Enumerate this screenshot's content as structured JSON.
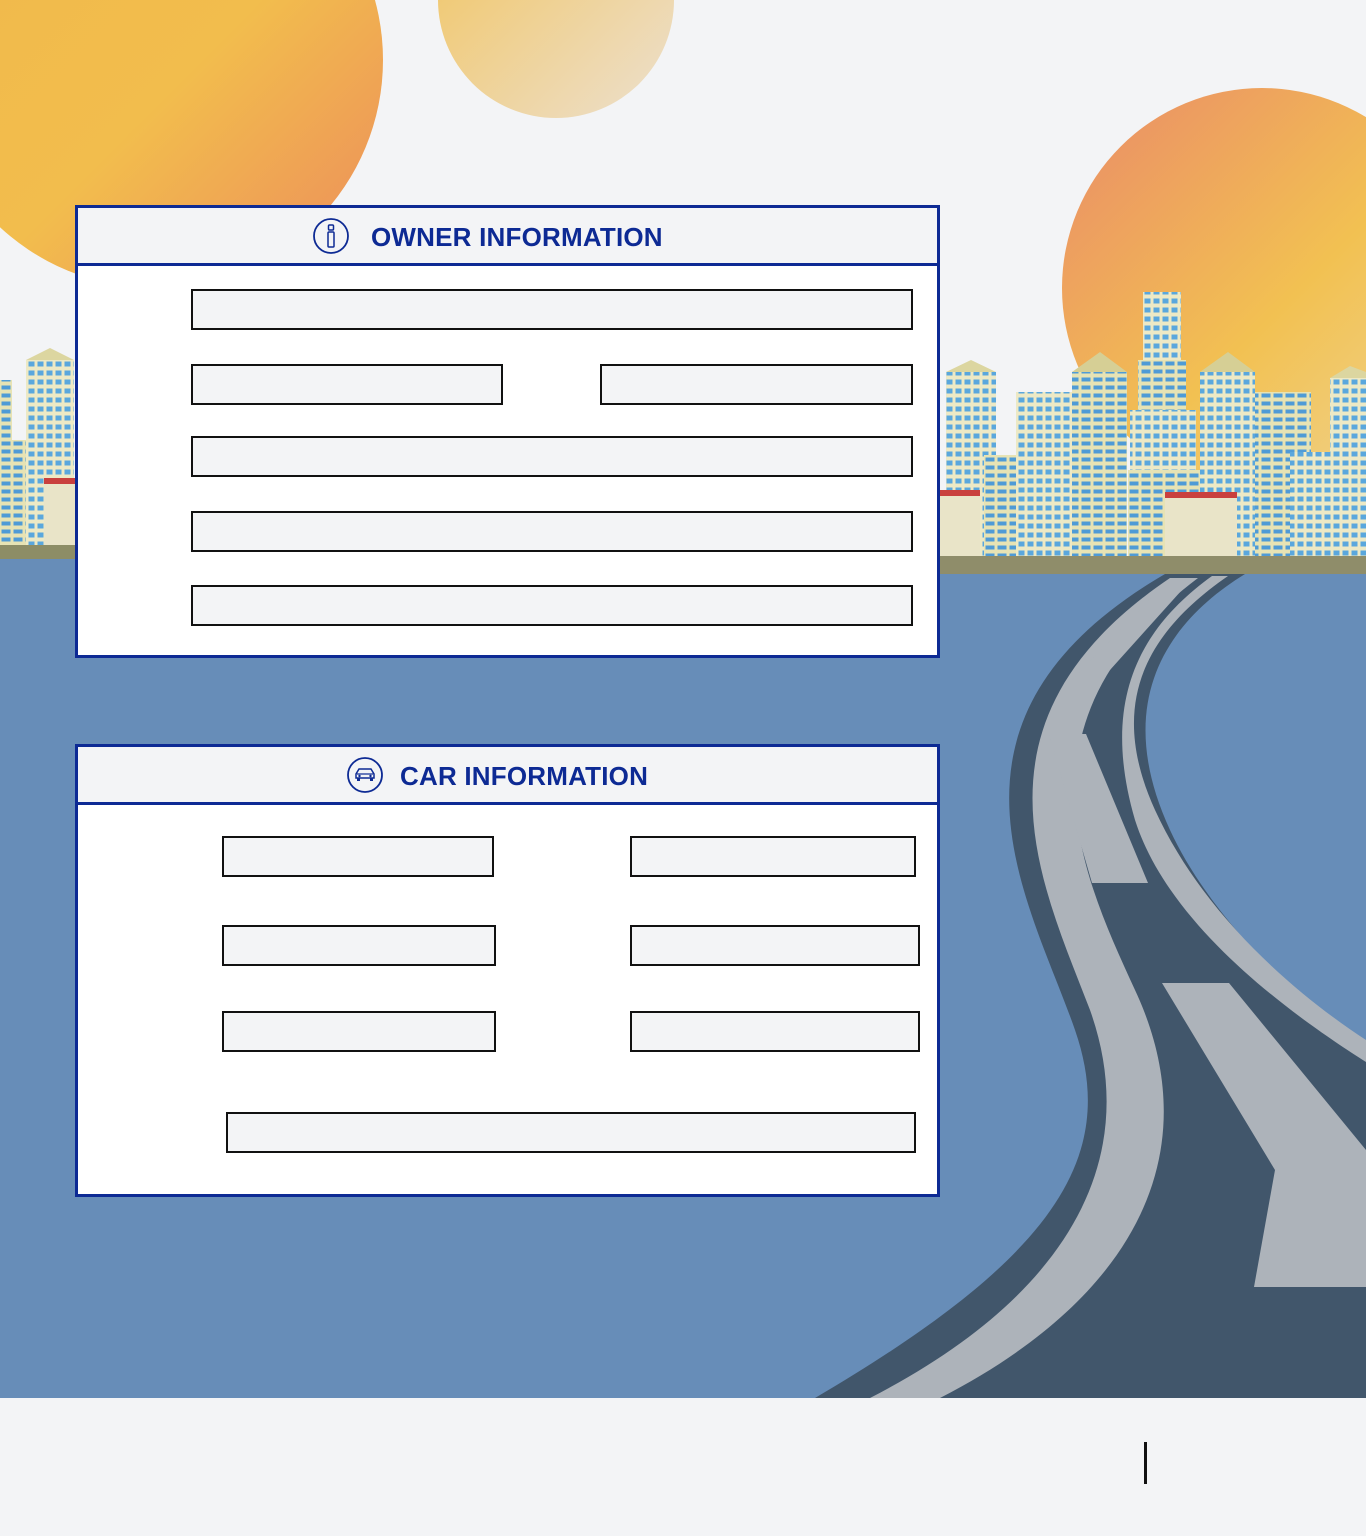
{
  "owner_section": {
    "title": "OWNER INFORMATION",
    "icon": "info-icon",
    "fields": [
      "",
      "",
      "",
      "",
      "",
      ""
    ]
  },
  "car_section": {
    "title": "CAR INFORMATION",
    "icon": "car-icon",
    "fields": [
      "",
      "",
      "",
      "",
      "",
      "",
      ""
    ]
  },
  "colors": {
    "accent": "#0d2a94",
    "sky": "#f3f4f6",
    "ground": "#678db8",
    "road": "#41566b",
    "road_lines": "#adb3ba",
    "sun": "#f1bb48"
  }
}
